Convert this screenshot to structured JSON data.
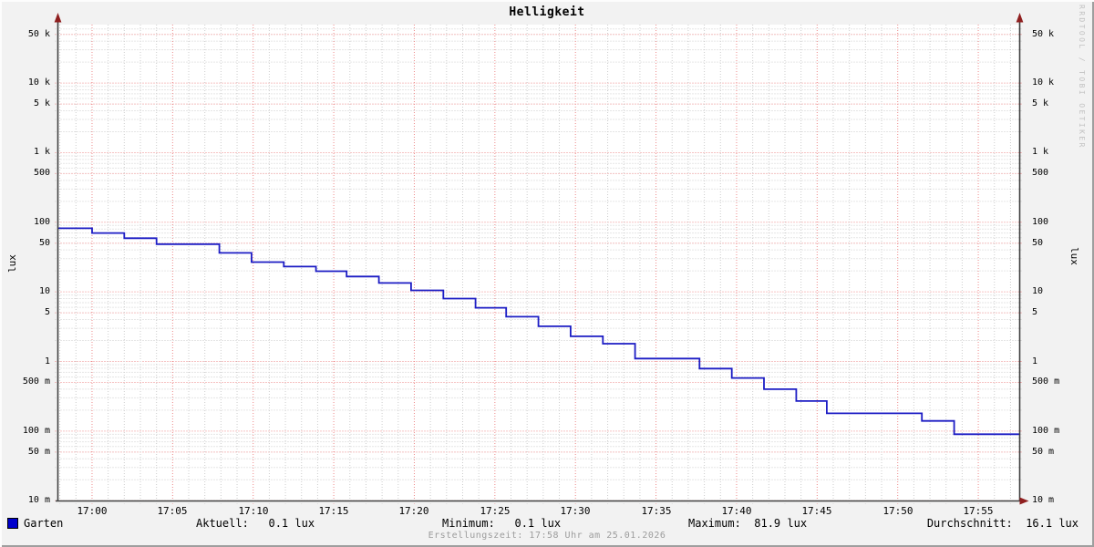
{
  "title": "Helligkeit",
  "watermark": "RRDTOOL / TOBI OETIKER",
  "y_axis": {
    "label": "lux",
    "ticks": [
      {
        "label": "50 k",
        "value": 50000
      },
      {
        "label": "10 k",
        "value": 10000
      },
      {
        "label": "5 k",
        "value": 5000
      },
      {
        "label": "1 k",
        "value": 1000
      },
      {
        "label": "500",
        "value": 500
      },
      {
        "label": "100",
        "value": 100
      },
      {
        "label": "50",
        "value": 50
      },
      {
        "label": "10",
        "value": 10
      },
      {
        "label": "5",
        "value": 5
      },
      {
        "label": "1",
        "value": 1
      },
      {
        "label": "500 m",
        "value": 0.5
      },
      {
        "label": "100 m",
        "value": 0.1
      },
      {
        "label": "50 m",
        "value": 0.05
      },
      {
        "label": "10 m",
        "value": 0.01
      }
    ]
  },
  "x_axis": {
    "ticks": [
      {
        "label": "17:00",
        "minute": 0
      },
      {
        "label": "17:05",
        "minute": 5
      },
      {
        "label": "17:10",
        "minute": 10
      },
      {
        "label": "17:15",
        "minute": 15
      },
      {
        "label": "17:20",
        "minute": 20
      },
      {
        "label": "17:25",
        "minute": 25
      },
      {
        "label": "17:30",
        "minute": 30
      },
      {
        "label": "17:35",
        "minute": 35
      },
      {
        "label": "17:40",
        "minute": 40
      },
      {
        "label": "17:45",
        "minute": 45
      },
      {
        "label": "17:50",
        "minute": 50
      },
      {
        "label": "17:55",
        "minute": 55
      }
    ]
  },
  "legend": {
    "series_label": "Garten",
    "stats": [
      {
        "label": "Aktuell",
        "value": "0.1 lux",
        "display": "Aktuell:   0.1 lux"
      },
      {
        "label": "Minimum",
        "value": "0.1 lux",
        "display": "Minimum:   0.1 lux"
      },
      {
        "label": "Maximum",
        "value": "81.9 lux",
        "display": "Maximum:  81.9 lux"
      },
      {
        "label": "Durchschnitt",
        "value": "16.1 lux",
        "display": "Durchschnitt:  16.1 lux"
      }
    ]
  },
  "footer": "Erstellungszeit: 17:58 Uhr am 25.01.2026",
  "colors": {
    "line": "#1c1cc4",
    "legend_square": "#0000cc",
    "major_grid": "#ee8a8a",
    "minor_grid": "#cdcdcd",
    "axis": "#404040",
    "arrow": "#8f1f1f",
    "background": "#f2f2f2",
    "plot_background": "#ffffff",
    "watermark_text": "#c2c2c2",
    "footer_text": "#9c9c9c"
  },
  "chart_data": {
    "type": "line",
    "line_style": "step-after",
    "title": "Helligkeit",
    "xlabel": "",
    "ylabel": "lux",
    "y_scale": "log",
    "ylim": [
      0.01,
      68000
    ],
    "x_range_minutes_after_1700": [
      -2.1,
      57.6
    ],
    "x_tick_minutes": [
      0,
      5,
      10,
      15,
      20,
      25,
      30,
      35,
      40,
      45,
      50,
      55
    ],
    "grid": true,
    "legend_position": "bottom",
    "stats": {
      "aktuell_lux": 0.1,
      "minimum_lux": 0.1,
      "maximum_lux": 81.9,
      "durchschnitt_lux": 16.1
    },
    "series": [
      {
        "name": "Garten",
        "color": "#1c1cc4",
        "points_minute_lux": [
          [
            -2.1,
            81.9
          ],
          [
            0,
            70
          ],
          [
            2,
            59
          ],
          [
            4,
            48.5
          ],
          [
            7.9,
            36.3
          ],
          [
            9.9,
            26.8
          ],
          [
            11.9,
            23.1
          ],
          [
            13.9,
            19.8
          ],
          [
            15.8,
            16.6
          ],
          [
            17.8,
            13.4
          ],
          [
            19.8,
            10.5
          ],
          [
            21.8,
            8.0
          ],
          [
            23.8,
            5.9
          ],
          [
            25.7,
            4.4
          ],
          [
            27.7,
            3.2
          ],
          [
            29.7,
            2.3
          ],
          [
            31.7,
            1.8
          ],
          [
            33.7,
            1.1
          ],
          [
            37.7,
            0.79
          ],
          [
            39.7,
            0.58
          ],
          [
            41.7,
            0.4
          ],
          [
            43.7,
            0.27
          ],
          [
            45.6,
            0.18
          ],
          [
            51.5,
            0.14
          ],
          [
            53.5,
            0.09
          ]
        ]
      }
    ]
  }
}
